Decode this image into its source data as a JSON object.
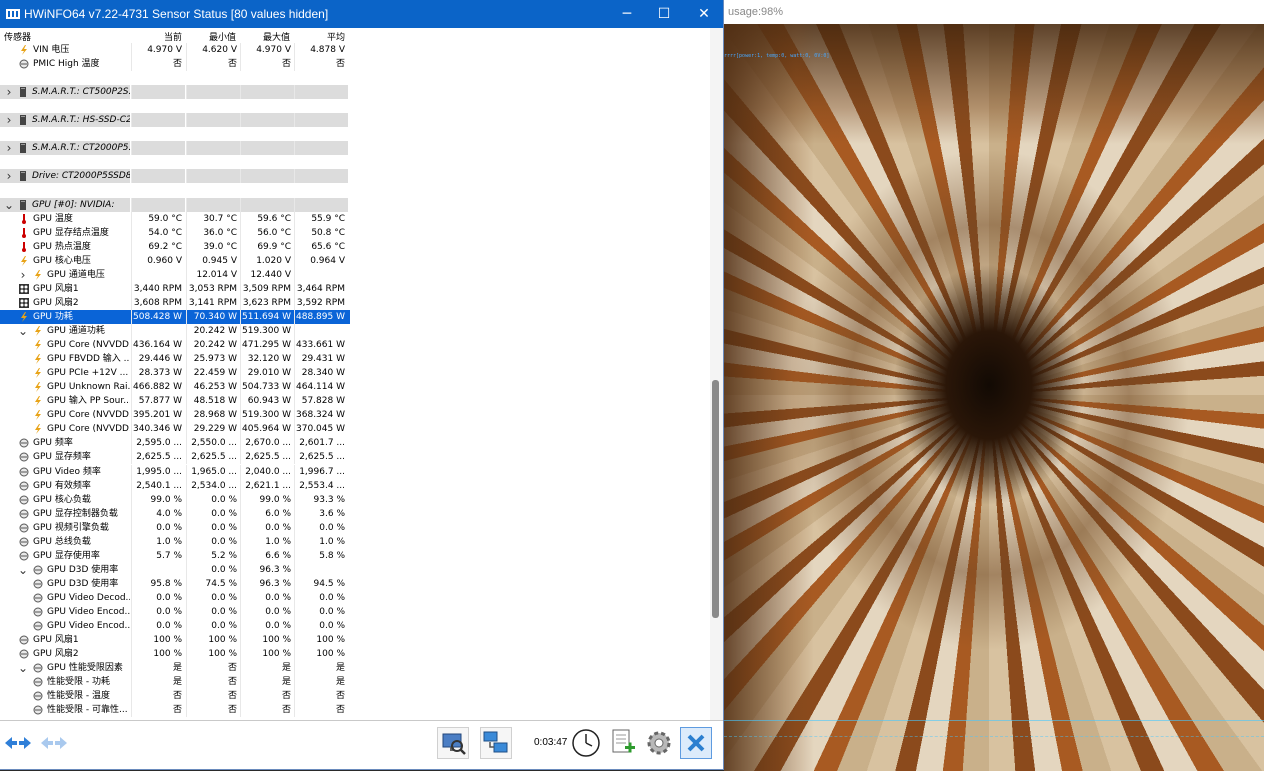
{
  "window": {
    "title": "HWiNFO64 v7.22-4731 Sensor Status [80 values hidden]",
    "minimize": "─",
    "maximize": "☐",
    "close": "✕"
  },
  "background": {
    "usage_text": "usage:98%",
    "caption": "rrrr[power:1, temp:0, watt:0, 0V:0]"
  },
  "table": {
    "headers": [
      "传感器",
      "当前",
      "最小值",
      "最大值",
      "平均"
    ],
    "rows": [
      {
        "icon": "bolt",
        "name": "VIN 电压",
        "v": [
          "4.970 V",
          "4.620 V",
          "4.970 V",
          "4.878 V"
        ],
        "indent": 1
      },
      {
        "icon": "circle",
        "name": "PMIC High 温度",
        "v": [
          "否",
          "否",
          "否",
          "否"
        ],
        "indent": 1
      },
      {
        "type": "blank"
      },
      {
        "type": "group",
        "icon": "disk",
        "name": "S.M.A.R.T.: CT500P2S...",
        "expand": ">"
      },
      {
        "type": "blank"
      },
      {
        "type": "group",
        "icon": "disk",
        "name": "S.M.A.R.T.: HS-SSD-C2...",
        "expand": ">"
      },
      {
        "type": "blank"
      },
      {
        "type": "group",
        "icon": "disk",
        "name": "S.M.A.R.T.: CT2000P5...",
        "expand": ">"
      },
      {
        "type": "blank"
      },
      {
        "type": "group",
        "icon": "disk",
        "name": "Drive: CT2000P5SSD8 ...",
        "expand": ">"
      },
      {
        "type": "blank"
      },
      {
        "type": "group",
        "icon": "disk",
        "name": "GPU [#0]: NVIDIA:",
        "expand": "v"
      },
      {
        "icon": "therm",
        "name": "GPU 温度",
        "v": [
          "59.0 °C",
          "30.7 °C",
          "59.6 °C",
          "55.9 °C"
        ],
        "indent": 1
      },
      {
        "icon": "therm",
        "name": "GPU 显存结点温度",
        "v": [
          "54.0 °C",
          "36.0 °C",
          "56.0 °C",
          "50.8 °C"
        ],
        "indent": 1
      },
      {
        "icon": "therm",
        "name": "GPU 热点温度",
        "v": [
          "69.2 °C",
          "39.0 °C",
          "69.9 °C",
          "65.6 °C"
        ],
        "indent": 1
      },
      {
        "icon": "bolt",
        "name": "GPU 核心电压",
        "v": [
          "0.960 V",
          "0.945 V",
          "1.020 V",
          "0.964 V"
        ],
        "indent": 1
      },
      {
        "icon": "bolt",
        "name": "GPU 通道电压",
        "v": [
          "",
          "12.014 V",
          "12.440 V",
          ""
        ],
        "indent": 2,
        "expand": ">"
      },
      {
        "icon": "fan",
        "name": "GPU 风扇1",
        "v": [
          "3,440 RPM",
          "3,053 RPM",
          "3,509 RPM",
          "3,464 RPM"
        ],
        "indent": 1
      },
      {
        "icon": "fan",
        "name": "GPU 风扇2",
        "v": [
          "3,608 RPM",
          "3,141 RPM",
          "3,623 RPM",
          "3,592 RPM"
        ],
        "indent": 1
      },
      {
        "icon": "bolt",
        "name": "GPU 功耗",
        "v": [
          "508.428 W",
          "70.340 W",
          "511.694 W",
          "488.895 W"
        ],
        "indent": 1,
        "selected": true
      },
      {
        "icon": "bolt",
        "name": "GPU 通道功耗",
        "v": [
          "",
          "20.242 W",
          "519.300 W",
          ""
        ],
        "indent": 2,
        "expand": "v"
      },
      {
        "icon": "bolt",
        "name": "GPU Core (NVVDD...",
        "v": [
          "436.164 W",
          "20.242 W",
          "471.295 W",
          "433.661 W"
        ],
        "indent": 3
      },
      {
        "icon": "bolt",
        "name": "GPU FBVDD 输入 ...",
        "v": [
          "29.446 W",
          "25.973 W",
          "32.120 W",
          "29.431 W"
        ],
        "indent": 3
      },
      {
        "icon": "bolt",
        "name": "GPU PCIe +12V ...",
        "v": [
          "28.373 W",
          "22.459 W",
          "29.010 W",
          "28.340 W"
        ],
        "indent": 3
      },
      {
        "icon": "bolt",
        "name": "GPU Unknown Rai...",
        "v": [
          "466.882 W",
          "46.253 W",
          "504.733 W",
          "464.114 W"
        ],
        "indent": 3
      },
      {
        "icon": "bolt",
        "name": "GPU 输入 PP Sour...",
        "v": [
          "57.877 W",
          "48.518 W",
          "60.943 W",
          "57.828 W"
        ],
        "indent": 3
      },
      {
        "icon": "bolt",
        "name": "GPU Core (NVVDD...",
        "v": [
          "395.201 W",
          "28.968 W",
          "519.300 W",
          "368.324 W"
        ],
        "indent": 3
      },
      {
        "icon": "bolt",
        "name": "GPU Core (NVVDD...",
        "v": [
          "340.346 W",
          "29.229 W",
          "405.964 W",
          "370.045 W"
        ],
        "indent": 3
      },
      {
        "icon": "circle",
        "name": "GPU 频率",
        "v": [
          "2,595.0 ...",
          "2,550.0 ...",
          "2,670.0 ...",
          "2,601.7 ..."
        ],
        "indent": 1
      },
      {
        "icon": "circle",
        "name": "GPU 显存频率",
        "v": [
          "2,625.5 ...",
          "2,625.5 ...",
          "2,625.5 ...",
          "2,625.5 ..."
        ],
        "indent": 1
      },
      {
        "icon": "circle",
        "name": "GPU Video 频率",
        "v": [
          "1,995.0 ...",
          "1,965.0 ...",
          "2,040.0 ...",
          "1,996.7 ..."
        ],
        "indent": 1
      },
      {
        "icon": "circle",
        "name": "GPU 有效频率",
        "v": [
          "2,540.1 ...",
          "2,534.0 ...",
          "2,621.1 ...",
          "2,553.4 ..."
        ],
        "indent": 1
      },
      {
        "icon": "circle",
        "name": "GPU 核心负载",
        "v": [
          "99.0 %",
          "0.0 %",
          "99.0 %",
          "93.3 %"
        ],
        "indent": 1
      },
      {
        "icon": "circle",
        "name": "GPU 显存控制器负载",
        "v": [
          "4.0 %",
          "0.0 %",
          "6.0 %",
          "3.6 %"
        ],
        "indent": 1
      },
      {
        "icon": "circle",
        "name": "GPU 视频引擎负载",
        "v": [
          "0.0 %",
          "0.0 %",
          "0.0 %",
          "0.0 %"
        ],
        "indent": 1
      },
      {
        "icon": "circle",
        "name": "GPU 总线负载",
        "v": [
          "1.0 %",
          "0.0 %",
          "1.0 %",
          "1.0 %"
        ],
        "indent": 1
      },
      {
        "icon": "circle",
        "name": "GPU 显存使用率",
        "v": [
          "5.7 %",
          "5.2 %",
          "6.6 %",
          "5.8 %"
        ],
        "indent": 1
      },
      {
        "icon": "circle",
        "name": "GPU D3D 使用率",
        "v": [
          "",
          "0.0 %",
          "96.3 %",
          ""
        ],
        "indent": 2,
        "expand": "v"
      },
      {
        "icon": "circle",
        "name": "GPU D3D 使用率",
        "v": [
          "95.8 %",
          "74.5 %",
          "96.3 %",
          "94.5 %"
        ],
        "indent": 3
      },
      {
        "icon": "circle",
        "name": "GPU Video Decod...",
        "v": [
          "0.0 %",
          "0.0 %",
          "0.0 %",
          "0.0 %"
        ],
        "indent": 3
      },
      {
        "icon": "circle",
        "name": "GPU Video Encod...",
        "v": [
          "0.0 %",
          "0.0 %",
          "0.0 %",
          "0.0 %"
        ],
        "indent": 3
      },
      {
        "icon": "circle",
        "name": "GPU Video Encod...",
        "v": [
          "0.0 %",
          "0.0 %",
          "0.0 %",
          "0.0 %"
        ],
        "indent": 3
      },
      {
        "icon": "circle",
        "name": "GPU 风扇1",
        "v": [
          "100 %",
          "100 %",
          "100 %",
          "100 %"
        ],
        "indent": 1
      },
      {
        "icon": "circle",
        "name": "GPU 风扇2",
        "v": [
          "100 %",
          "100 %",
          "100 %",
          "100 %"
        ],
        "indent": 1
      },
      {
        "icon": "circle",
        "name": "GPU 性能受限因素",
        "v": [
          "是",
          "否",
          "是",
          "是"
        ],
        "indent": 2,
        "expand": "v"
      },
      {
        "icon": "circle",
        "name": "性能受限 - 功耗",
        "v": [
          "是",
          "否",
          "是",
          "是"
        ],
        "indent": 3
      },
      {
        "icon": "circle",
        "name": "性能受限 - 温度",
        "v": [
          "否",
          "否",
          "否",
          "否"
        ],
        "indent": 3
      },
      {
        "icon": "circle",
        "name": "性能受限 - 可靠性...",
        "v": [
          "否",
          "否",
          "否",
          "否"
        ],
        "indent": 3
      }
    ]
  },
  "toolbar": {
    "timer": "0:03:47"
  },
  "colors": {
    "titlebar": "#0b64c8",
    "selection": "#0a64d7"
  }
}
